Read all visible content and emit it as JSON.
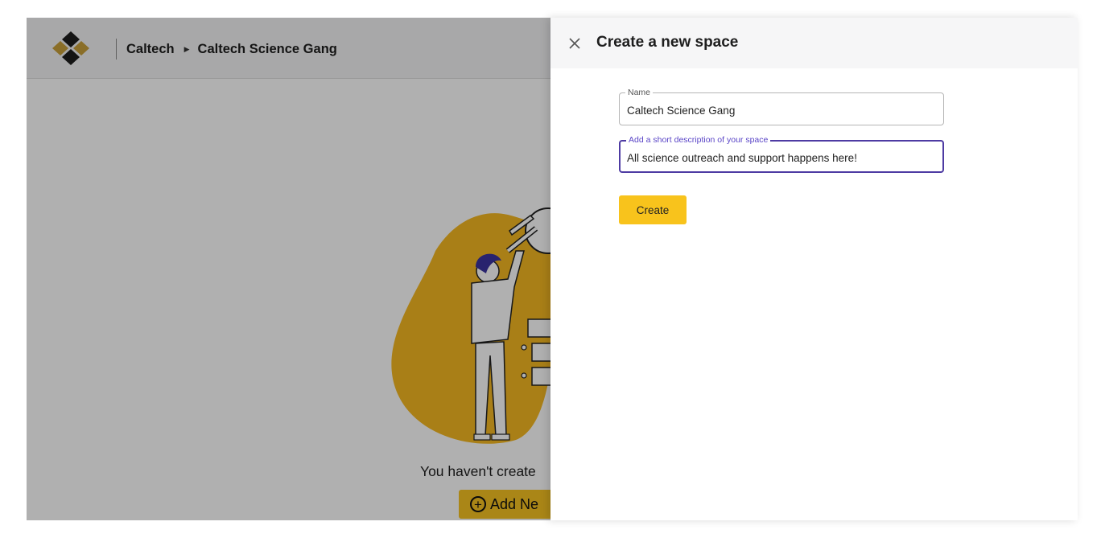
{
  "header": {
    "breadcrumb_root": "Caltech",
    "breadcrumb_current": "Caltech Science Gang"
  },
  "main": {
    "empty_message": "You haven't create",
    "add_new_label": "Add Ne"
  },
  "drawer": {
    "title": "Create a new space",
    "name_label": "Name",
    "name_value": "Caltech Science Gang",
    "description_label": "Add a short description of your space",
    "description_value": "All science outreach and support happens here!",
    "create_label": "Create"
  },
  "colors": {
    "accent": "#f8c31c",
    "focus": "#4e3ba3",
    "overlay": "rgba(0,0,0,0.31)"
  },
  "icons": {
    "logo": "logo-icon",
    "breadcrumb_separator": "caret-right-icon",
    "close": "close-icon",
    "add": "plus-circle-icon"
  }
}
